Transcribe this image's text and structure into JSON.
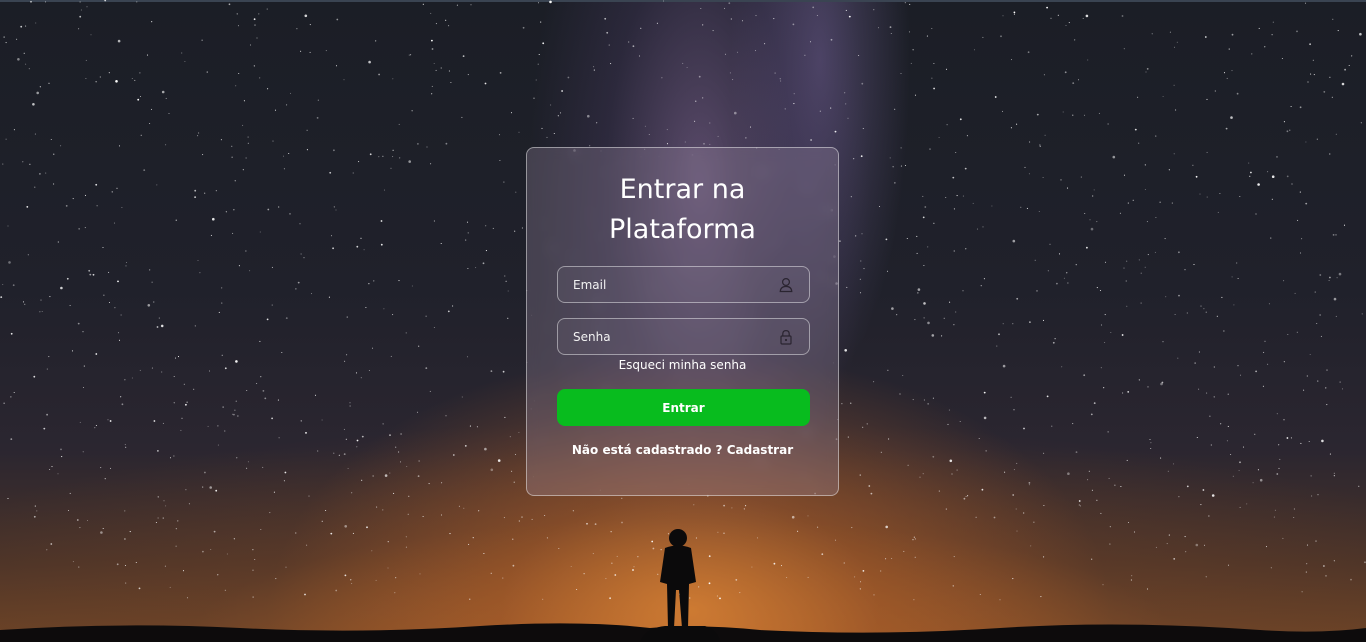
{
  "login": {
    "title_line1": "Entrar na",
    "title_line2": "Plataforma",
    "email_placeholder": "Email",
    "password_placeholder": "Senha",
    "forgot_password": "Esqueci minha senha",
    "submit_label": "Entrar",
    "signup_prompt": "Não está cadastrado ?",
    "signup_link": "Cadastrar"
  },
  "icons": {
    "email_field": "user-icon",
    "password_field": "lock-icon"
  },
  "colors": {
    "submit_button": "#08bc1e",
    "text": "#ffffff"
  }
}
